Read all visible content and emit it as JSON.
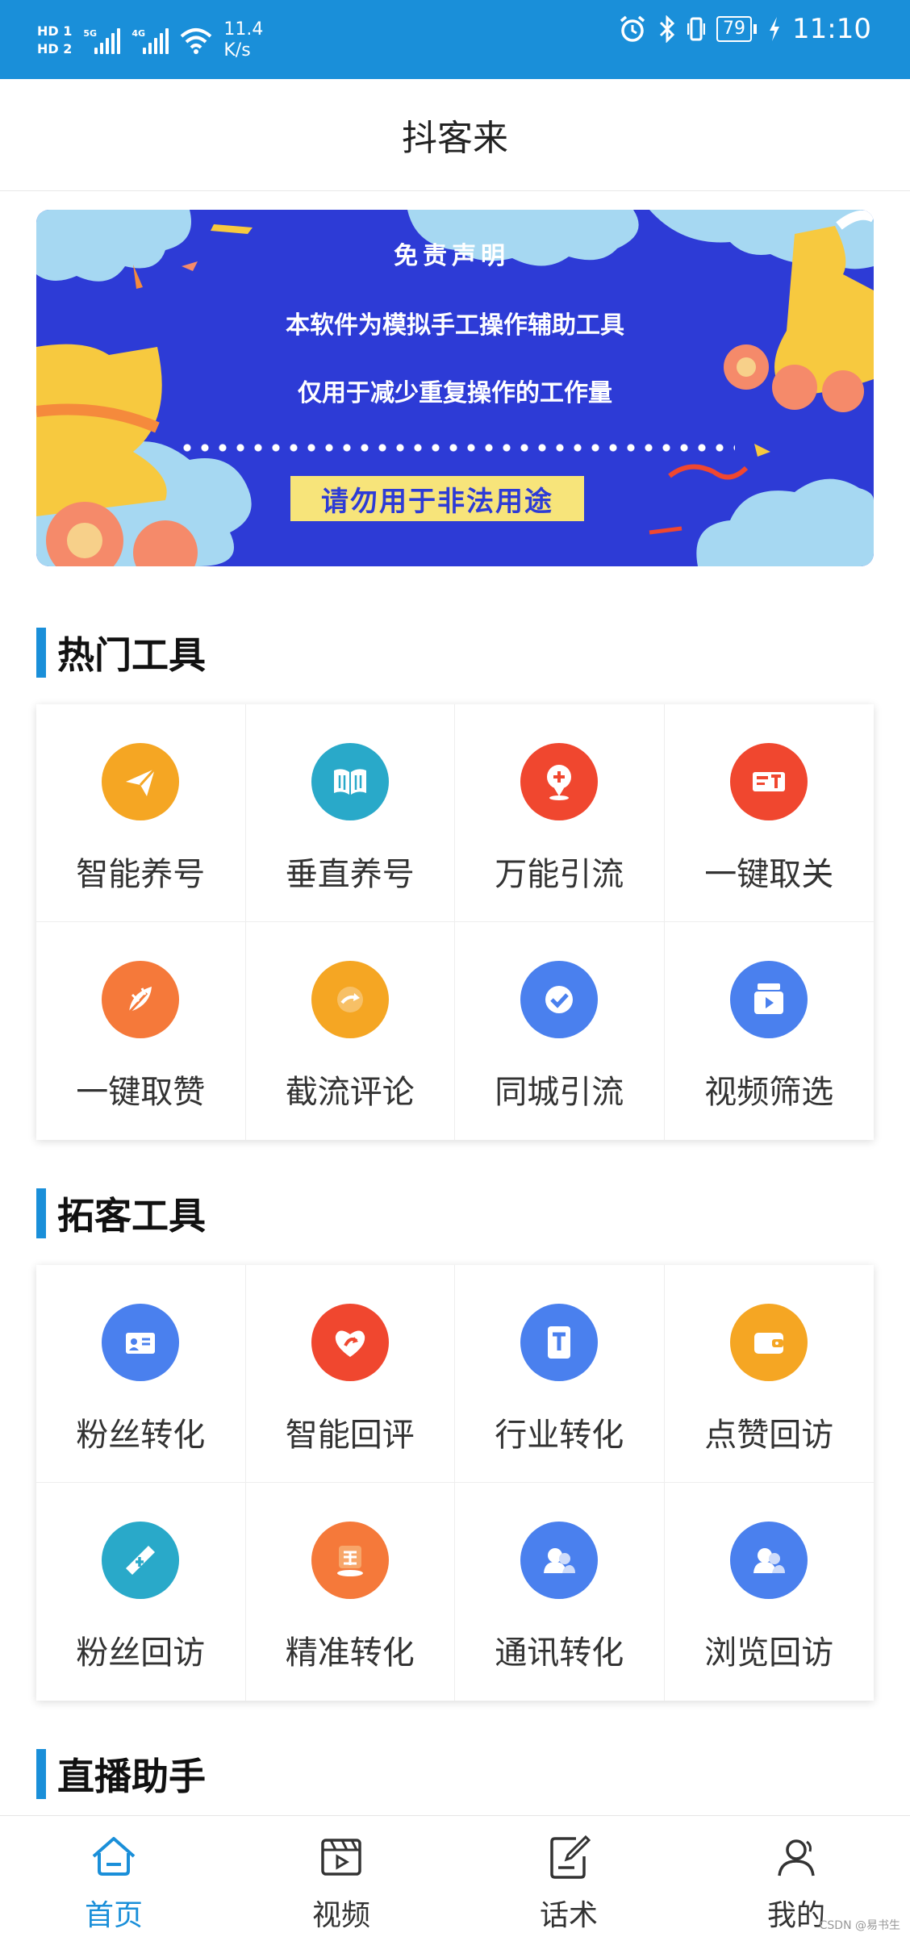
{
  "status_bar": {
    "sim1": "HD 1",
    "sim2": "HD 2",
    "net1": "5G",
    "net2": "4G",
    "speed_value": "11.4",
    "speed_unit": "K/s",
    "battery": "79",
    "time": "11:10",
    "icons": [
      "alarm-icon",
      "bluetooth-icon",
      "vibrate-icon",
      "battery-icon",
      "charging-icon"
    ]
  },
  "header": {
    "title": "抖客来"
  },
  "banner": {
    "title": "免责声明",
    "line1": "本软件为模拟手工操作辅助工具",
    "line2": "仅用于减少重复操作的工作量",
    "warning": "请勿用于非法用途"
  },
  "sections": {
    "hot": {
      "title": "热门工具",
      "items": [
        {
          "label": "智能养号",
          "icon": "paper-plane-icon",
          "color": "#f5a623"
        },
        {
          "label": "垂直养号",
          "icon": "book-icon",
          "color": "#29a9c9"
        },
        {
          "label": "万能引流",
          "icon": "location-plus-icon",
          "color": "#f0472f"
        },
        {
          "label": "一键取关",
          "icon": "ticket-icon",
          "color": "#f0472f"
        },
        {
          "label": "一键取赞",
          "icon": "feather-icon",
          "color": "#f5793a"
        },
        {
          "label": "截流评论",
          "icon": "comment-arrow-icon",
          "color": "#f5a623"
        },
        {
          "label": "同城引流",
          "icon": "check-circle-icon",
          "color": "#4a80ee"
        },
        {
          "label": "视频筛选",
          "icon": "video-play-icon",
          "color": "#4a80ee"
        }
      ]
    },
    "expand": {
      "title": "拓客工具",
      "items": [
        {
          "label": "粉丝转化",
          "icon": "card-icon",
          "color": "#4a80ee"
        },
        {
          "label": "智能回评",
          "icon": "heart-icon",
          "color": "#f0472f"
        },
        {
          "label": "行业转化",
          "icon": "tablet-t-icon",
          "color": "#4a80ee"
        },
        {
          "label": "点赞回访",
          "icon": "wallet-icon",
          "color": "#f5a623"
        },
        {
          "label": "粉丝回访",
          "icon": "stamp-icon",
          "color": "#29a9c9"
        },
        {
          "label": "精准转化",
          "icon": "score-badge-icon",
          "color": "#f5793a"
        },
        {
          "label": "通讯转化",
          "icon": "users-icon",
          "color": "#4a80ee"
        },
        {
          "label": "浏览回访",
          "icon": "users-icon",
          "color": "#4a80ee"
        }
      ]
    },
    "live": {
      "title": "直播助手"
    }
  },
  "nav": {
    "items": [
      {
        "label": "首页",
        "icon": "home-icon",
        "active": true
      },
      {
        "label": "视频",
        "icon": "video-icon",
        "active": false
      },
      {
        "label": "话术",
        "icon": "edit-icon",
        "active": false
      },
      {
        "label": "我的",
        "icon": "user-icon",
        "active": false
      }
    ]
  },
  "watermark": "CSDN @易书生",
  "colors": {
    "accent": "#1a8fd9",
    "banner_bg": "#2d3bd6",
    "banner_warning_bg": "#f7e47a"
  }
}
